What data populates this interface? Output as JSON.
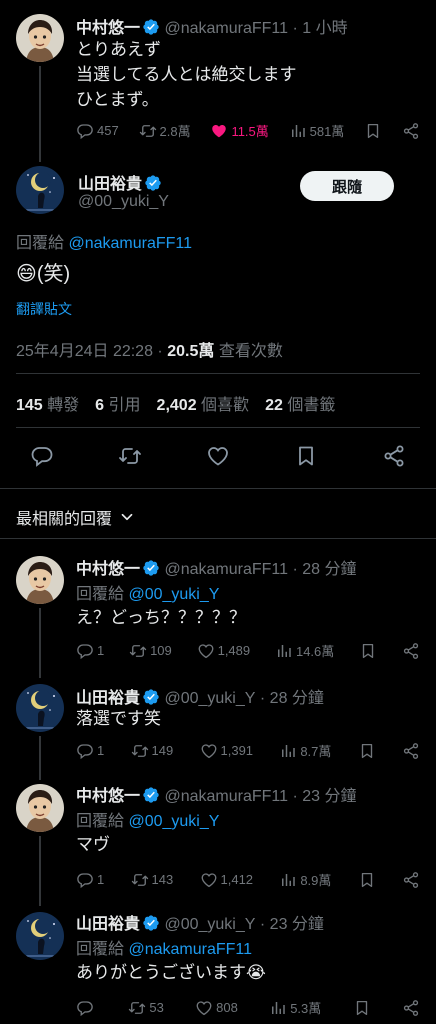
{
  "parent": {
    "name": "中村悠一",
    "handle": "@nakamuraFF11",
    "time": "· 1 小時",
    "text": "とりあえず\n当選してる人とは絶交します\nひとまず。",
    "replies": "457",
    "retweets": "2.8萬",
    "likes": "11.5萬",
    "views": "581萬"
  },
  "main": {
    "name": "山田裕貴",
    "handle": "@00_yuki_Y",
    "follow_label": "跟隨",
    "reply_to_prefix": "回覆給",
    "reply_to_handle": "@nakamuraFF11",
    "emoji": "😄",
    "text": "(笑)",
    "translate_label": "翻譯貼文",
    "datetime": "25年4月24日 22:28 ·",
    "views_count": "20.5萬",
    "views_label": "查看次數",
    "stats": [
      {
        "count": "145",
        "label": "轉發"
      },
      {
        "count": "6",
        "label": "引用"
      },
      {
        "count": "2,402",
        "label": "個喜歡"
      },
      {
        "count": "22",
        "label": "個書籤"
      }
    ]
  },
  "sort": {
    "label": "最相關的回覆"
  },
  "replies": [
    {
      "name": "中村悠一",
      "handle": "@nakamuraFF11",
      "time": "· 28 分鐘",
      "reply_prefix": "回覆給",
      "reply_handle": "@00_yuki_Y",
      "text": "え？どっち？？？？？",
      "replies": "1",
      "retweets": "109",
      "likes": "1,489",
      "views": "14.6萬"
    },
    {
      "name": "山田裕貴",
      "handle": "@00_yuki_Y",
      "time": "· 28 分鐘",
      "text": "落選です笑",
      "replies": "1",
      "retweets": "149",
      "likes": "1,391",
      "views": "8.7萬"
    },
    {
      "name": "中村悠一",
      "handle": "@nakamuraFF11",
      "time": "· 23 分鐘",
      "reply_prefix": "回覆給",
      "reply_handle": "@00_yuki_Y",
      "text": "マヴ",
      "replies": "1",
      "retweets": "143",
      "likes": "1,412",
      "views": "8.9萬"
    },
    {
      "name": "山田裕貴",
      "handle": "@00_yuki_Y",
      "time": "· 23 分鐘",
      "reply_prefix": "回覆給",
      "reply_handle": "@nakamuraFF11",
      "text": "ありがとうございます😭",
      "replies": "",
      "retweets": "53",
      "likes": "808",
      "views": "5.3萬"
    }
  ],
  "colors": {
    "accent": "#1d9bf0",
    "like": "#f91880",
    "muted": "#71767b"
  }
}
